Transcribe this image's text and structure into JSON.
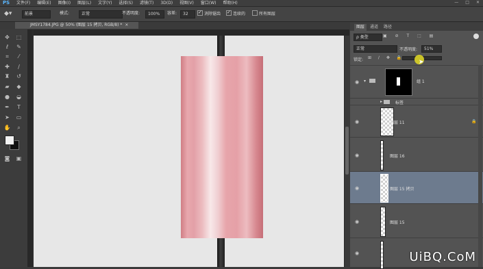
{
  "app": {
    "logo": "PS"
  },
  "menu": [
    "文件(F)",
    "编辑(E)",
    "图像(I)",
    "图层(L)",
    "文字(Y)",
    "选择(S)",
    "滤镜(T)",
    "3D(D)",
    "视图(V)",
    "窗口(W)",
    "帮助(H)"
  ],
  "window_controls": [
    "—",
    "□",
    "✕"
  ],
  "options": {
    "tool_icon": "gradient-bucket-icon",
    "preset_label": "前景",
    "mode_label": "模式:",
    "mode_value": "正常",
    "opacity_label": "不透明度:",
    "opacity_value": "100%",
    "tolerance_label": "容差:",
    "tolerance_value": "32",
    "anti_alias_label": "消除锯齿",
    "contiguous_label": "连续的",
    "all_layers_label": "所有图层"
  },
  "document": {
    "tab_title": "JMSY1784.JPG @ 50% (图层 15 拷贝, RGB/8) *",
    "close": "×"
  },
  "layers_panel": {
    "tabs": [
      "图层",
      "通道",
      "路径"
    ],
    "filter_label": "ρ 类型",
    "blend_mode": "正常",
    "opacity_label": "不透明度:",
    "opacity_value": "51%",
    "lock_label": "锁定:",
    "layers": [
      {
        "name": "组 1",
        "type": "group"
      },
      {
        "name": "标签",
        "type": "folder"
      },
      {
        "name": "图层 11",
        "type": "layer"
      },
      {
        "name": "图层 16",
        "type": "layer"
      },
      {
        "name": "图层 15 拷贝",
        "type": "layer"
      },
      {
        "name": "图层 15",
        "type": "layer"
      }
    ]
  },
  "watermark": "UiBQ.CoM"
}
